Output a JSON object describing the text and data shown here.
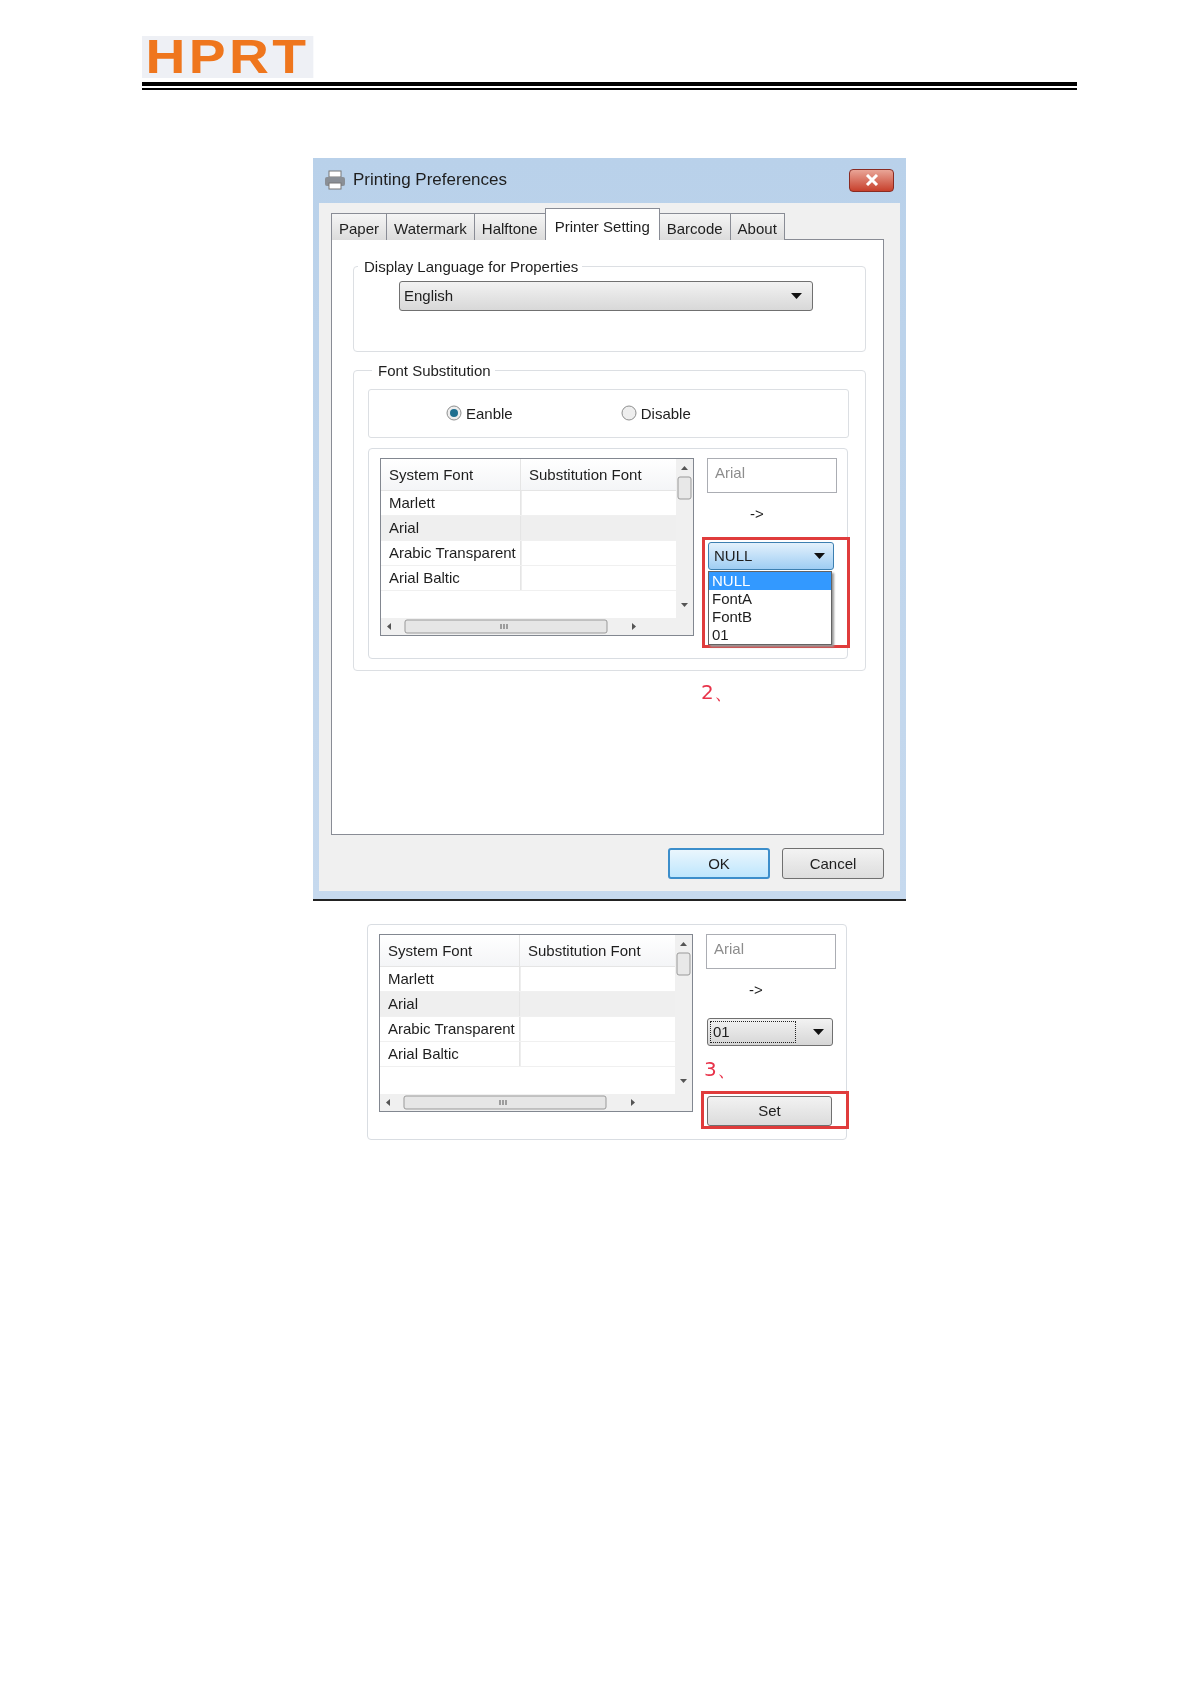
{
  "header": {
    "logo": "HPRT"
  },
  "dialog": {
    "title": "Printing Preferences",
    "tabs": [
      {
        "label": "Paper",
        "selected": false
      },
      {
        "label": "Watermark",
        "selected": false
      },
      {
        "label": "Halftone",
        "selected": false
      },
      {
        "label": "Printer Setting",
        "selected": true
      },
      {
        "label": "Barcode",
        "selected": false
      },
      {
        "label": "About",
        "selected": false
      }
    ],
    "language_group": {
      "title": "Display Language for Properties",
      "value": "English"
    },
    "font_group": {
      "title": "Font Substitution",
      "options": [
        {
          "label": "Eanble",
          "selected": true
        },
        {
          "label": "Disable",
          "selected": false
        }
      ],
      "panel": {
        "columns": [
          "System Font",
          "Substitution Font"
        ],
        "rows": [
          {
            "system_font": "Marlett",
            "selected": false
          },
          {
            "system_font": "Arial",
            "selected": true
          },
          {
            "system_font": "Arabic Transparent",
            "selected": false
          },
          {
            "system_font": "Arial Baltic",
            "selected": false
          }
        ],
        "controls": [
          {
            "kind": "field",
            "value": "Arial",
            "disabled": true
          },
          {
            "kind": "arrow",
            "text": "->"
          },
          {
            "kind": "combo",
            "value": "NULL",
            "open": true,
            "focused": false,
            "highlighted": true,
            "options": [
              {
                "label": "NULL",
                "selected": true
              },
              {
                "label": "FontA",
                "selected": false
              },
              {
                "label": "FontB",
                "selected": false
              },
              {
                "label": "01",
                "selected": false
              }
            ]
          }
        ]
      }
    },
    "step_label": "2、",
    "buttons": [
      {
        "label": "OK",
        "default": true
      },
      {
        "label": "Cancel",
        "default": false
      }
    ]
  },
  "detail_panel": {
    "columns": [
      "System Font",
      "Substitution Font"
    ],
    "rows": [
      {
        "system_font": "Marlett",
        "selected": false
      },
      {
        "system_font": "Arial",
        "selected": true
      },
      {
        "system_font": "Arabic Transparent",
        "selected": false
      },
      {
        "system_font": "Arial Baltic",
        "selected": false
      }
    ],
    "controls": [
      {
        "kind": "field",
        "value": "Arial",
        "disabled": true
      },
      {
        "kind": "arrow",
        "text": "->"
      },
      {
        "kind": "combo",
        "value": "01",
        "open": false,
        "focused": true,
        "highlighted": false
      },
      {
        "kind": "step",
        "text": "3、"
      },
      {
        "kind": "button",
        "label": "Set",
        "highlighted": true
      }
    ]
  }
}
